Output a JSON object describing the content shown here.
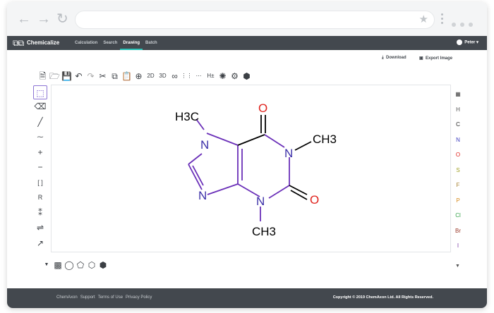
{
  "browser": {
    "back_icon": "back-arrow-icon",
    "forward_icon": "forward-arrow-icon",
    "reload_icon": "reload-icon",
    "bookmark_icon": "star-icon",
    "menu_icon": "kebab-menu-icon"
  },
  "app": {
    "brand": "Chemicalize",
    "menu": [
      {
        "label": "Calculation",
        "active": false
      },
      {
        "label": "Search",
        "active": false
      },
      {
        "label": "Drawing",
        "active": true
      },
      {
        "label": "Batch",
        "active": false
      }
    ],
    "user": "Peter",
    "accent_color": "#27c0b4",
    "header_color": "#43484e"
  },
  "actions": {
    "download": "Download",
    "export_image": "Export Image"
  },
  "top_toolbar": {
    "icons": [
      "new-document-icon",
      "open-folder-icon",
      "save-icon",
      "undo-icon",
      "redo-icon",
      "cut-icon",
      "copy-icon",
      "paste-icon",
      "zoom-icon",
      "rotate-2d-icon",
      "rotate-3d-icon",
      "link-icon",
      "arrange-icon",
      "mapping-icon",
      "hydrogen-icon",
      "clean-icon",
      "settings-icon",
      "info-icon"
    ],
    "h_label": "H±"
  },
  "left_toolbar": {
    "icons": [
      "select-icon",
      "eraser-icon",
      "single-bond-icon",
      "chain-icon",
      "plus-charge-icon",
      "minus-charge-icon",
      "bracket-icon",
      "r-group-icon",
      "stereo-icon",
      "reaction-arrow-icon",
      "multi-center-icon"
    ],
    "plus": "+",
    "minus": "−"
  },
  "right_toolbar": {
    "periodic_table_icon": "periodic-table-icon",
    "elements": [
      {
        "symbol": "H",
        "color": "#555555"
      },
      {
        "symbol": "C",
        "color": "#222222"
      },
      {
        "symbol": "N",
        "color": "#3b3bbf"
      },
      {
        "symbol": "O",
        "color": "#e0231d"
      },
      {
        "symbol": "S",
        "color": "#9e9e20"
      },
      {
        "symbol": "F",
        "color": "#a7802f"
      },
      {
        "symbol": "P",
        "color": "#d68a1c"
      },
      {
        "symbol": "Cl",
        "color": "#35a34b"
      },
      {
        "symbol": "Br",
        "color": "#9b3a2a"
      },
      {
        "symbol": "I",
        "color": "#7c3aa6"
      }
    ]
  },
  "bottom_toolbar": {
    "icons": [
      "expand-icon",
      "template-icon",
      "shield-icon",
      "pentagon-icon",
      "hexagon-icon",
      "cube-icon"
    ]
  },
  "molecule": {
    "name_hint": "caffeine",
    "atoms": {
      "methyl_top": "H3C",
      "n7": "N",
      "n9": "N",
      "n1": "N",
      "n3": "N",
      "o_top": "O",
      "o_right": "O",
      "methyl_right": "CH3",
      "methyl_bottom": "CH3"
    },
    "bond_color": "#6a2fb8",
    "oxygen_color": "#e0231d"
  },
  "footer": {
    "links": [
      "ChemAxon",
      "Support",
      "Terms of Use",
      "Privacy Policy"
    ],
    "copyright": "Copyright © 2019 ChemAxon Ltd. All Rights Reserved."
  }
}
